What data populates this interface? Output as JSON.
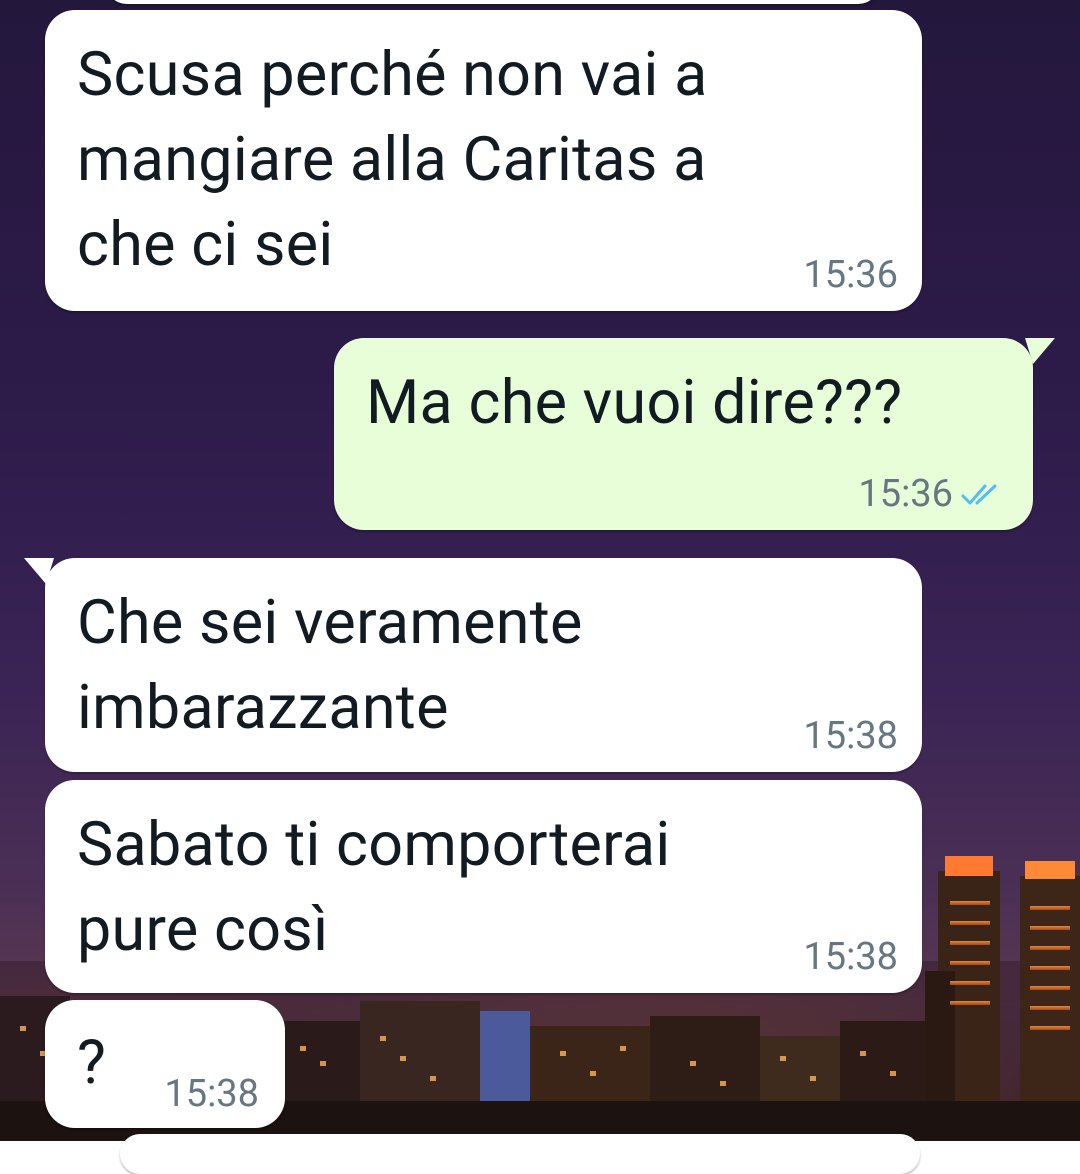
{
  "chat": {
    "messages": [
      {
        "direction": "in",
        "text": "Scusa perché non vai a\nmangiare alla Caritas a\nche ci sei",
        "time": "15:36"
      },
      {
        "direction": "out",
        "text": "Ma che vuoi dire???",
        "time": "15:36",
        "status": "read-double-check-icon"
      },
      {
        "direction": "in",
        "text": "Che sei veramente\nimbarazzante",
        "time": "15:38"
      },
      {
        "direction": "in",
        "text": "Sabato ti comporterai\npure così",
        "time": "15:38"
      },
      {
        "direction": "in",
        "text": "?",
        "time": "15:38"
      }
    ]
  },
  "colors": {
    "incoming_bubble": "#ffffff",
    "outgoing_bubble": "#e7fed8",
    "timestamp": "#667781",
    "read_ticks": "#53bdeb"
  },
  "wallpaper": {
    "description_icon": "city-skyline-night-wallpaper"
  }
}
